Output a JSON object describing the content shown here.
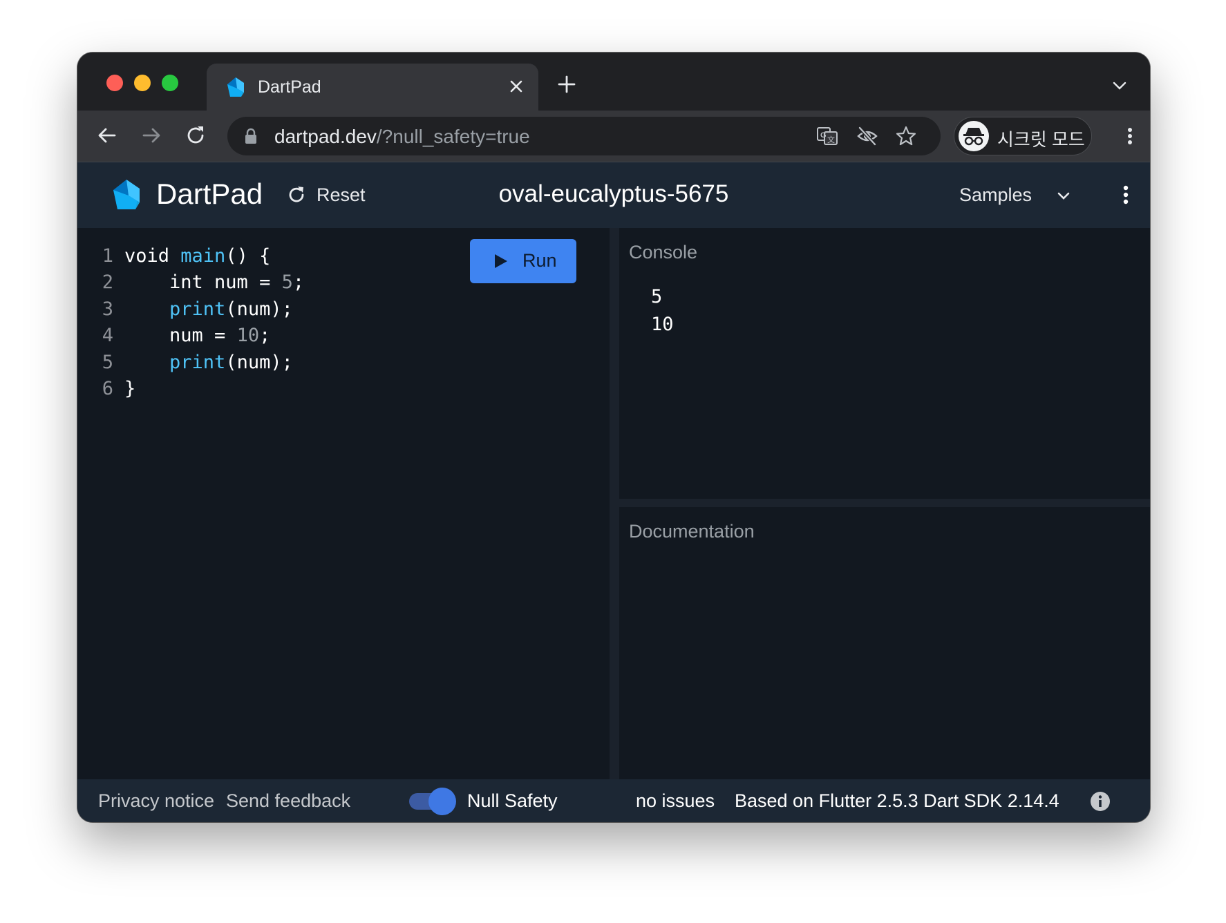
{
  "browser": {
    "tab": {
      "title": "DartPad"
    },
    "url": {
      "host": "dartpad.dev",
      "path": "/?null_safety=true"
    },
    "profile": {
      "label": "시크릿 모드"
    },
    "icons": [
      "back-icon",
      "forward-icon",
      "reload-icon",
      "lock-icon",
      "translate-icon",
      "eye-off-icon",
      "star-icon",
      "incognito-icon",
      "more-vert-icon"
    ]
  },
  "header": {
    "app_title": "DartPad",
    "reset_label": "Reset",
    "project_name": "oval-eucalyptus-5675",
    "samples_label": "Samples"
  },
  "editor": {
    "run_label": "Run",
    "lines": [
      {
        "n": "1",
        "segments": [
          {
            "t": "void ",
            "c": "plain"
          },
          {
            "t": "main",
            "c": "fn"
          },
          {
            "t": "() {",
            "c": "plain"
          }
        ]
      },
      {
        "n": "2",
        "segments": [
          {
            "t": "    int num = ",
            "c": "plain"
          },
          {
            "t": "5",
            "c": "num"
          },
          {
            "t": ";",
            "c": "plain"
          }
        ]
      },
      {
        "n": "3",
        "segments": [
          {
            "t": "    ",
            "c": "plain"
          },
          {
            "t": "print",
            "c": "fn"
          },
          {
            "t": "(num);",
            "c": "plain"
          }
        ]
      },
      {
        "n": "4",
        "segments": [
          {
            "t": "    num = ",
            "c": "plain"
          },
          {
            "t": "10",
            "c": "num"
          },
          {
            "t": ";",
            "c": "plain"
          }
        ]
      },
      {
        "n": "5",
        "segments": [
          {
            "t": "    ",
            "c": "plain"
          },
          {
            "t": "print",
            "c": "fn"
          },
          {
            "t": "(num);",
            "c": "plain"
          }
        ]
      },
      {
        "n": "6",
        "segments": [
          {
            "t": "}",
            "c": "plain"
          }
        ]
      }
    ]
  },
  "console": {
    "title": "Console",
    "output": [
      "5",
      "10"
    ]
  },
  "documentation": {
    "title": "Documentation"
  },
  "footer": {
    "privacy": "Privacy notice",
    "feedback": "Send feedback",
    "null_safety_label": "Null Safety",
    "null_safety_enabled": true,
    "issues": "no issues",
    "version": "Based on Flutter 2.5.3 Dart SDK 2.14.4"
  },
  "colors": {
    "accent": "#3f84f1",
    "editor_bg": "#121820",
    "header_bg": "#1c2734",
    "code_function": "#4fc3f7"
  }
}
